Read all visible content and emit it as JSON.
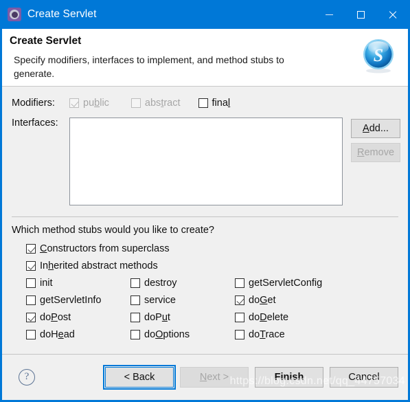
{
  "window": {
    "title": "Create Servlet",
    "icon": "gear-icon",
    "accent_color": "#0078d7",
    "controls": [
      {
        "name": "minimize",
        "glyph": "–"
      },
      {
        "name": "maximize",
        "glyph": "□"
      },
      {
        "name": "close",
        "glyph": "✕"
      }
    ]
  },
  "header": {
    "title": "Create Servlet",
    "description": "Specify modifiers, interfaces to implement, and method stubs to generate.",
    "logo": "servlet-s-logo"
  },
  "form": {
    "modifiers_label": "Modifiers:",
    "modifiers": [
      {
        "label": "public",
        "mnemonic": "p",
        "checked": true,
        "enabled": false
      },
      {
        "label": "abstract",
        "mnemonic": "t",
        "checked": false,
        "enabled": false
      },
      {
        "label": "final",
        "mnemonic": "l",
        "checked": false,
        "enabled": true
      }
    ],
    "interfaces_label": "Interfaces:",
    "interfaces_items": [],
    "add_button": "Add...",
    "add_mnemonic": "A",
    "remove_button": "Remove",
    "remove_mnemonic": "R",
    "remove_enabled": false
  },
  "stubs": {
    "question": "Which method stubs would you like to create?",
    "primary": [
      {
        "label": "Constructors from superclass",
        "mnemonic": "C",
        "checked": true
      },
      {
        "label": "Inherited abstract methods",
        "mnemonic": "h",
        "checked": true
      }
    ],
    "methods": [
      {
        "label": "init",
        "mnemonic": "",
        "checked": false
      },
      {
        "label": "destroy",
        "mnemonic": "",
        "checked": false
      },
      {
        "label": "getServletConfig",
        "mnemonic": "",
        "checked": false
      },
      {
        "label": "getServletInfo",
        "mnemonic": "",
        "checked": false
      },
      {
        "label": "service",
        "mnemonic": "",
        "checked": false
      },
      {
        "label": "doGet",
        "mnemonic": "G",
        "checked": true
      },
      {
        "label": "doPost",
        "mnemonic": "P",
        "checked": true
      },
      {
        "label": "doPut",
        "mnemonic": "u",
        "checked": false
      },
      {
        "label": "doDelete",
        "mnemonic": "D",
        "checked": false
      },
      {
        "label": "doHead",
        "mnemonic": "e",
        "checked": false
      },
      {
        "label": "doOptions",
        "mnemonic": "O",
        "checked": false
      },
      {
        "label": "doTrace",
        "mnemonic": "T",
        "checked": false
      }
    ]
  },
  "footer": {
    "help": "?",
    "back_button": "< Back",
    "next_button": "Next >",
    "next_mnemonic": "N",
    "next_enabled": false,
    "finish_button": "Finish",
    "cancel_button": "Cancel"
  },
  "watermark": "https://blog.csdn.net/qq_44757034"
}
